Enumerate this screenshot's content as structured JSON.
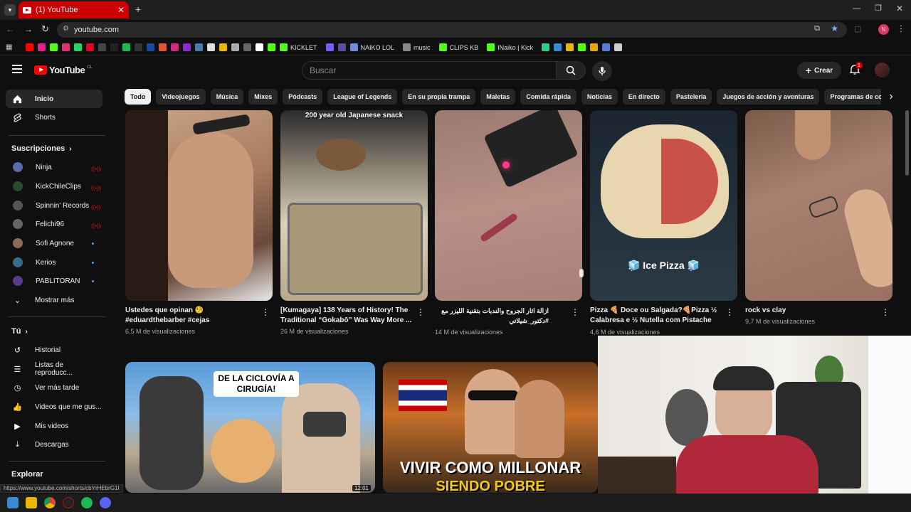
{
  "browser": {
    "tab_title": "(1) YouTube",
    "url": "youtube.com",
    "bookmarks": [
      {
        "label": "KICKLET",
        "color": "#53fc18"
      },
      {
        "label": "NAIKO LOL",
        "color": "#7289da"
      },
      {
        "label": "music",
        "color": "#888888"
      },
      {
        "label": "CLIPS KB",
        "color": "#53fc18"
      },
      {
        "label": "INaiko | Kick",
        "color": "#53fc18"
      }
    ],
    "status_url": "https://www.youtube.com/shorts/cbYrHEbrG1I"
  },
  "header": {
    "logo": "YouTube",
    "country_code": "CL",
    "search_placeholder": "Buscar",
    "create_label": "Crear",
    "notification_count": "1",
    "profile_initial": "N"
  },
  "sidebar": {
    "home": "Inicio",
    "shorts": "Shorts",
    "subscriptions_heading": "Suscripciones",
    "subscriptions": [
      {
        "name": "Ninja",
        "status": "live",
        "color": "#5b6aa8"
      },
      {
        "name": "KickChileClips",
        "status": "live",
        "color": "#2d4a2d"
      },
      {
        "name": "Spinnin' Records",
        "status": "live",
        "color": "#555555"
      },
      {
        "name": "Felichi96",
        "status": "live",
        "color": "#666666"
      },
      {
        "name": "Sofi Agnone",
        "status": "new",
        "color": "#8a6a5a"
      },
      {
        "name": "Kerios",
        "status": "new",
        "color": "#3a6a8a"
      },
      {
        "name": "PABLITORAN",
        "status": "new",
        "color": "#5a3a8a"
      }
    ],
    "show_more": "Mostrar más",
    "you_heading": "Tú",
    "you_items": [
      "Historial",
      "Listas de reproducc...",
      "Ver más tarde",
      "Videos que me gus...",
      "Mis videos",
      "Descargas"
    ],
    "explore_heading": "Explorar"
  },
  "chips": [
    "Todo",
    "Videojuegos",
    "Música",
    "Mixes",
    "Pódcasts",
    "League of Legends",
    "En su propia trampa",
    "Maletas",
    "Comida rápida",
    "Noticias",
    "En directo",
    "Pastelería",
    "Juegos de acción y aventuras",
    "Programas de coci"
  ],
  "shorts": [
    {
      "title": "Ustedes que opinan 🧐 #eduardthebarber #cejas",
      "views": "6,5 M de visualizaciones"
    },
    {
      "title": "[Kumagaya] 138 Years of History! The Traditional “Gokabō” Was Way More ...",
      "views": "26 M de visualizaciones",
      "overlay": "200 year old Japanese snack"
    },
    {
      "title": "ازالة اثار الجروح والندبات بتقنية الليزر مع #دكتور_شيلاتي",
      "views": "14 M de visualizaciones"
    },
    {
      "title": "Pizza 🍕 Doce ou Salgada?🍕Pizza ½ Calabresa e ½ Nutella com Pistache",
      "views": "4,6 M de visualizaciones",
      "overlay": "🧊 Ice Pizza 🧊"
    },
    {
      "title": "rock vs clay",
      "views": "9,7 M de visualizaciones"
    }
  ],
  "videos": [
    {
      "overlay": "DE LA CICLOVÍA A CIRUGÍA!",
      "duration": "12:01"
    },
    {
      "overlay_1": "VIVIR COMO MILLONAR",
      "overlay_2": "SIENDO POBRE"
    }
  ]
}
